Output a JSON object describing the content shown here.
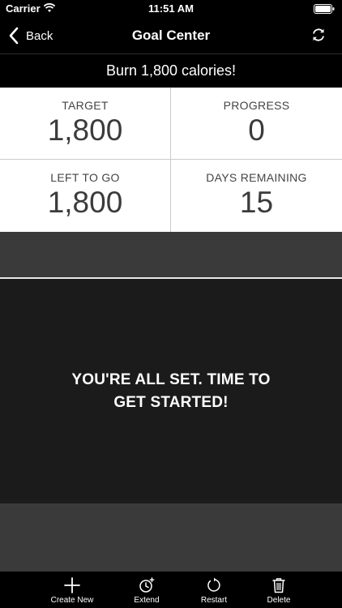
{
  "status_bar": {
    "carrier": "Carrier",
    "time": "11:51 AM"
  },
  "nav": {
    "back_label": "Back",
    "title": "Goal Center"
  },
  "goal": {
    "banner": "Burn 1,800 calories!"
  },
  "stats": [
    {
      "label": "TARGET",
      "value": "1,800"
    },
    {
      "label": "PROGRESS",
      "value": "0"
    },
    {
      "label": "LEFT TO GO",
      "value": "1,800"
    },
    {
      "label": "DAYS REMAINING",
      "value": "15"
    }
  ],
  "message": {
    "line1": "YOU'RE ALL SET. TIME TO",
    "line2": "GET STARTED!"
  },
  "toolbar": {
    "create_label": "Create New",
    "extend_label": "Extend",
    "restart_label": "Restart",
    "delete_label": "Delete"
  },
  "icons": {
    "wifi": "wifi-icon",
    "battery": "battery-icon",
    "back": "chevron-left-icon",
    "refresh": "refresh-icon",
    "create": "plus-icon",
    "extend": "clock-plus-icon",
    "restart": "restart-icon",
    "delete": "trash-icon"
  }
}
